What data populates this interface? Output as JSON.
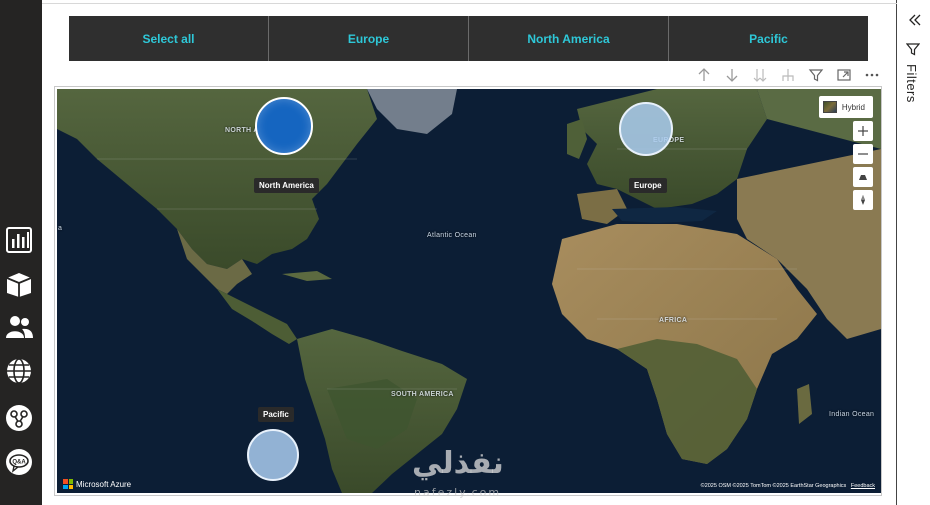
{
  "slicer": {
    "buttons": [
      "Select all",
      "Europe",
      "North America",
      "Pacific"
    ]
  },
  "visual_header": {
    "icons": [
      "arrow-up-icon",
      "arrow-down-icon",
      "double-arrow-down-icon",
      "expand-hierarchy-icon",
      "filter-icon",
      "focus-mode-icon",
      "more-options-icon"
    ]
  },
  "map": {
    "style_button": "Hybrid",
    "bubbles": [
      {
        "name": "North America",
        "region_label": "NORTH AMERICA"
      },
      {
        "name": "Europe",
        "region_label": "EUROPE"
      },
      {
        "name": "Pacific"
      }
    ],
    "labels": {
      "atlantic": "Atlantic Ocean",
      "africa": "AFRICA",
      "south_america": "SOUTH AMERICA",
      "indian": "Indian Ocean",
      "edge_left": "a"
    },
    "brand": "Microsoft Azure",
    "attribution": "©2025 OSM  ©2025 TomTom  ©2025 EarthStar Geographics",
    "feedback": "Feedback"
  },
  "filters": {
    "label": "Filters"
  },
  "watermark": {
    "text": "نفذلي",
    "sub": "nafezly.com"
  },
  "colors": {
    "rail": "#252423",
    "slicer_text": "#2ec8d8",
    "bubble_dark": "#1565c0",
    "bubble_light": "#aacdf0"
  }
}
